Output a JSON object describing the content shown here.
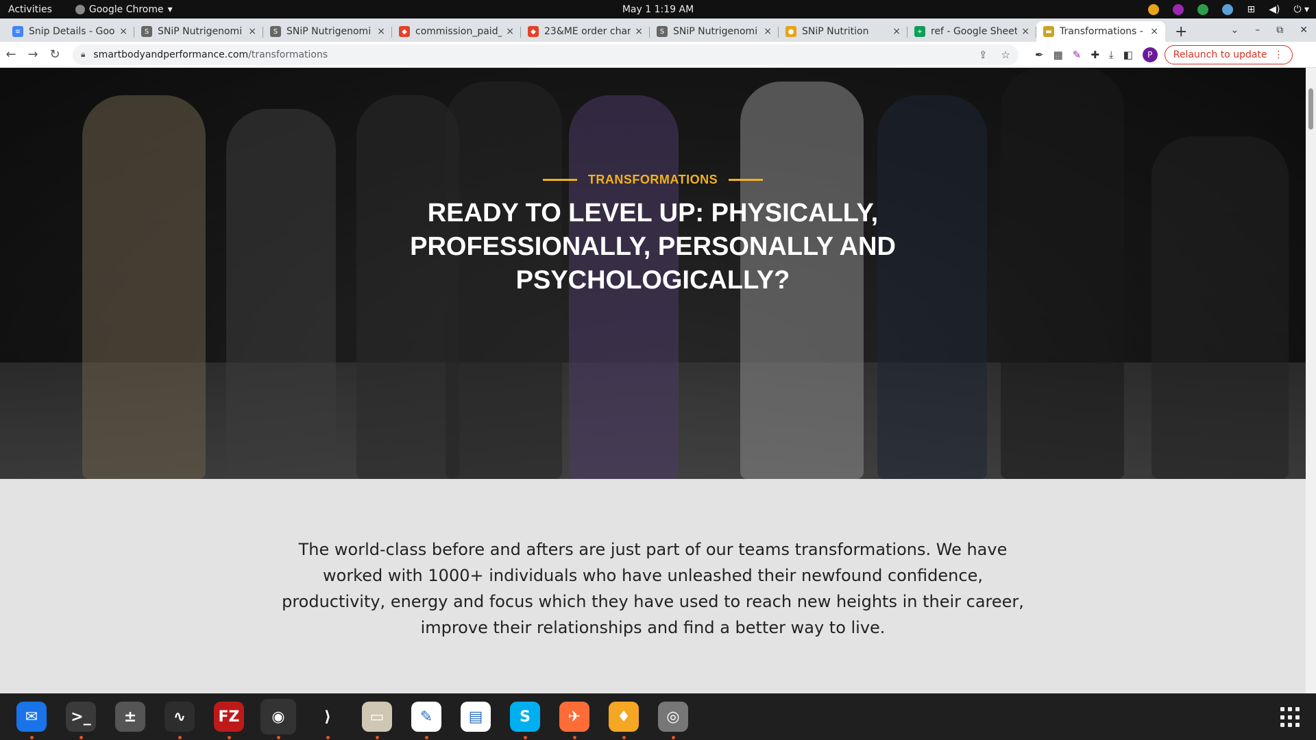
{
  "topbar": {
    "activities": "Activities",
    "app_name": "Google Chrome",
    "clock": "May 1  1:19 AM"
  },
  "tabs": [
    {
      "title": "Snip Details - Goo",
      "favicon_color": "#4285f4",
      "favicon_glyph": "≡"
    },
    {
      "title": "SNiP Nutrigenomi",
      "favicon_color": "#666666",
      "favicon_glyph": "S"
    },
    {
      "title": "SNiP Nutrigenomi",
      "favicon_color": "#666666",
      "favicon_glyph": "S"
    },
    {
      "title": "commission_paid_",
      "favicon_color": "#e24329",
      "favicon_glyph": "◆"
    },
    {
      "title": "23&ME order char",
      "favicon_color": "#e24329",
      "favicon_glyph": "◆"
    },
    {
      "title": "SNiP Nutrigenomi",
      "favicon_color": "#666666",
      "favicon_glyph": "S"
    },
    {
      "title": "SNiP Nutrition",
      "favicon_color": "#e8a317",
      "favicon_glyph": "●"
    },
    {
      "title": "ref - Google Sheet",
      "favicon_color": "#0f9d58",
      "favicon_glyph": "+"
    },
    {
      "title": "Transformations -",
      "favicon_color": "#c9a227",
      "favicon_glyph": "▬",
      "active": true
    }
  ],
  "tab_close": "×",
  "new_tab": "+",
  "address": {
    "host": "smartbodyandperformance.com",
    "path": "/transformations"
  },
  "relaunch_label": "Relaunch to update",
  "avatar_letter": "P",
  "hero": {
    "eyebrow": "TRANSFORMATIONS",
    "headline": "READY TO LEVEL UP: PHYSICALLY, PROFESSIONALLY, PERSONALLY AND PSYCHOLOGICALLY?"
  },
  "intro": "The world-class before and afters are just part of our teams transformations. We have worked with 1000+ individuals who have unleashed their newfound confidence, productivity, energy and focus which they have used to reach new heights in their career, improve their relationships and find a better way to live.",
  "dock": [
    {
      "name": "thunderbird-icon",
      "color": "#1a73e8",
      "glyph": "✉",
      "running": true
    },
    {
      "name": "terminal-icon",
      "color": "#3a3a3a",
      "glyph": ">_",
      "running": true
    },
    {
      "name": "calculator-icon",
      "color": "#555555",
      "glyph": "±",
      "running": false
    },
    {
      "name": "system-monitor-icon",
      "color": "#2d2d2d",
      "glyph": "∿",
      "running": true
    },
    {
      "name": "filezilla-icon",
      "color": "#bf1a1a",
      "glyph": "FZ",
      "running": true
    },
    {
      "name": "chrome-icon",
      "color": "#333333",
      "glyph": "◉",
      "running": true,
      "active": true
    },
    {
      "name": "vscode-icon",
      "color": "#1f1f1f",
      "glyph": "⟩",
      "running": true
    },
    {
      "name": "files-icon",
      "color": "#cfc6b4",
      "glyph": "▭",
      "running": true
    },
    {
      "name": "text-editor-icon",
      "color": "#ffffff",
      "glyph": "✎",
      "running": true
    },
    {
      "name": "libreoffice-writer-icon",
      "color": "#ffffff",
      "glyph": "▤",
      "running": false
    },
    {
      "name": "skype-icon",
      "color": "#00aff0",
      "glyph": "S",
      "running": true
    },
    {
      "name": "postman-icon",
      "color": "#ff6c37",
      "glyph": "✈",
      "running": true
    },
    {
      "name": "firebase-icon",
      "color": "#f5a623",
      "glyph": "♦",
      "running": true
    },
    {
      "name": "disk-icon",
      "color": "#777777",
      "glyph": "◎",
      "running": true
    }
  ]
}
